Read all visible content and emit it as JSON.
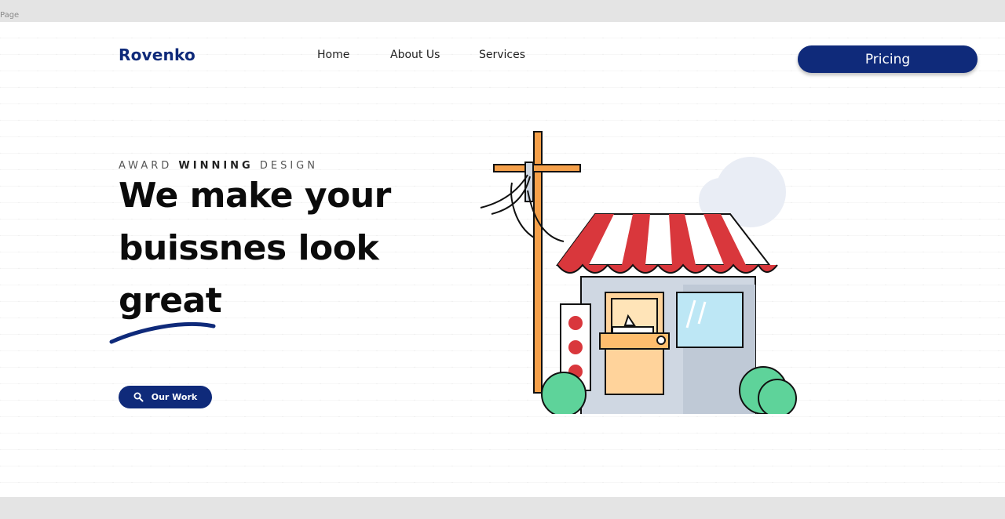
{
  "frame": {
    "label": "Page"
  },
  "header": {
    "logo": "Rovenko",
    "nav": [
      {
        "label": "Home"
      },
      {
        "label": "About Us"
      },
      {
        "label": "Services"
      }
    ],
    "cta_label": "Pricing"
  },
  "hero": {
    "eyebrow_prefix": "AWARD",
    "eyebrow_bold": "WINNING",
    "eyebrow_suffix": "DESIGN",
    "headline_lines": [
      "We make your",
      "buissnes look",
      "great"
    ],
    "button_label": "Our Work",
    "button_icon": "search-icon"
  },
  "colors": {
    "brand": "#0f2a7a",
    "awning_red": "#d9373c",
    "bush_green": "#5ed39a",
    "pole": "#f5a04a"
  }
}
